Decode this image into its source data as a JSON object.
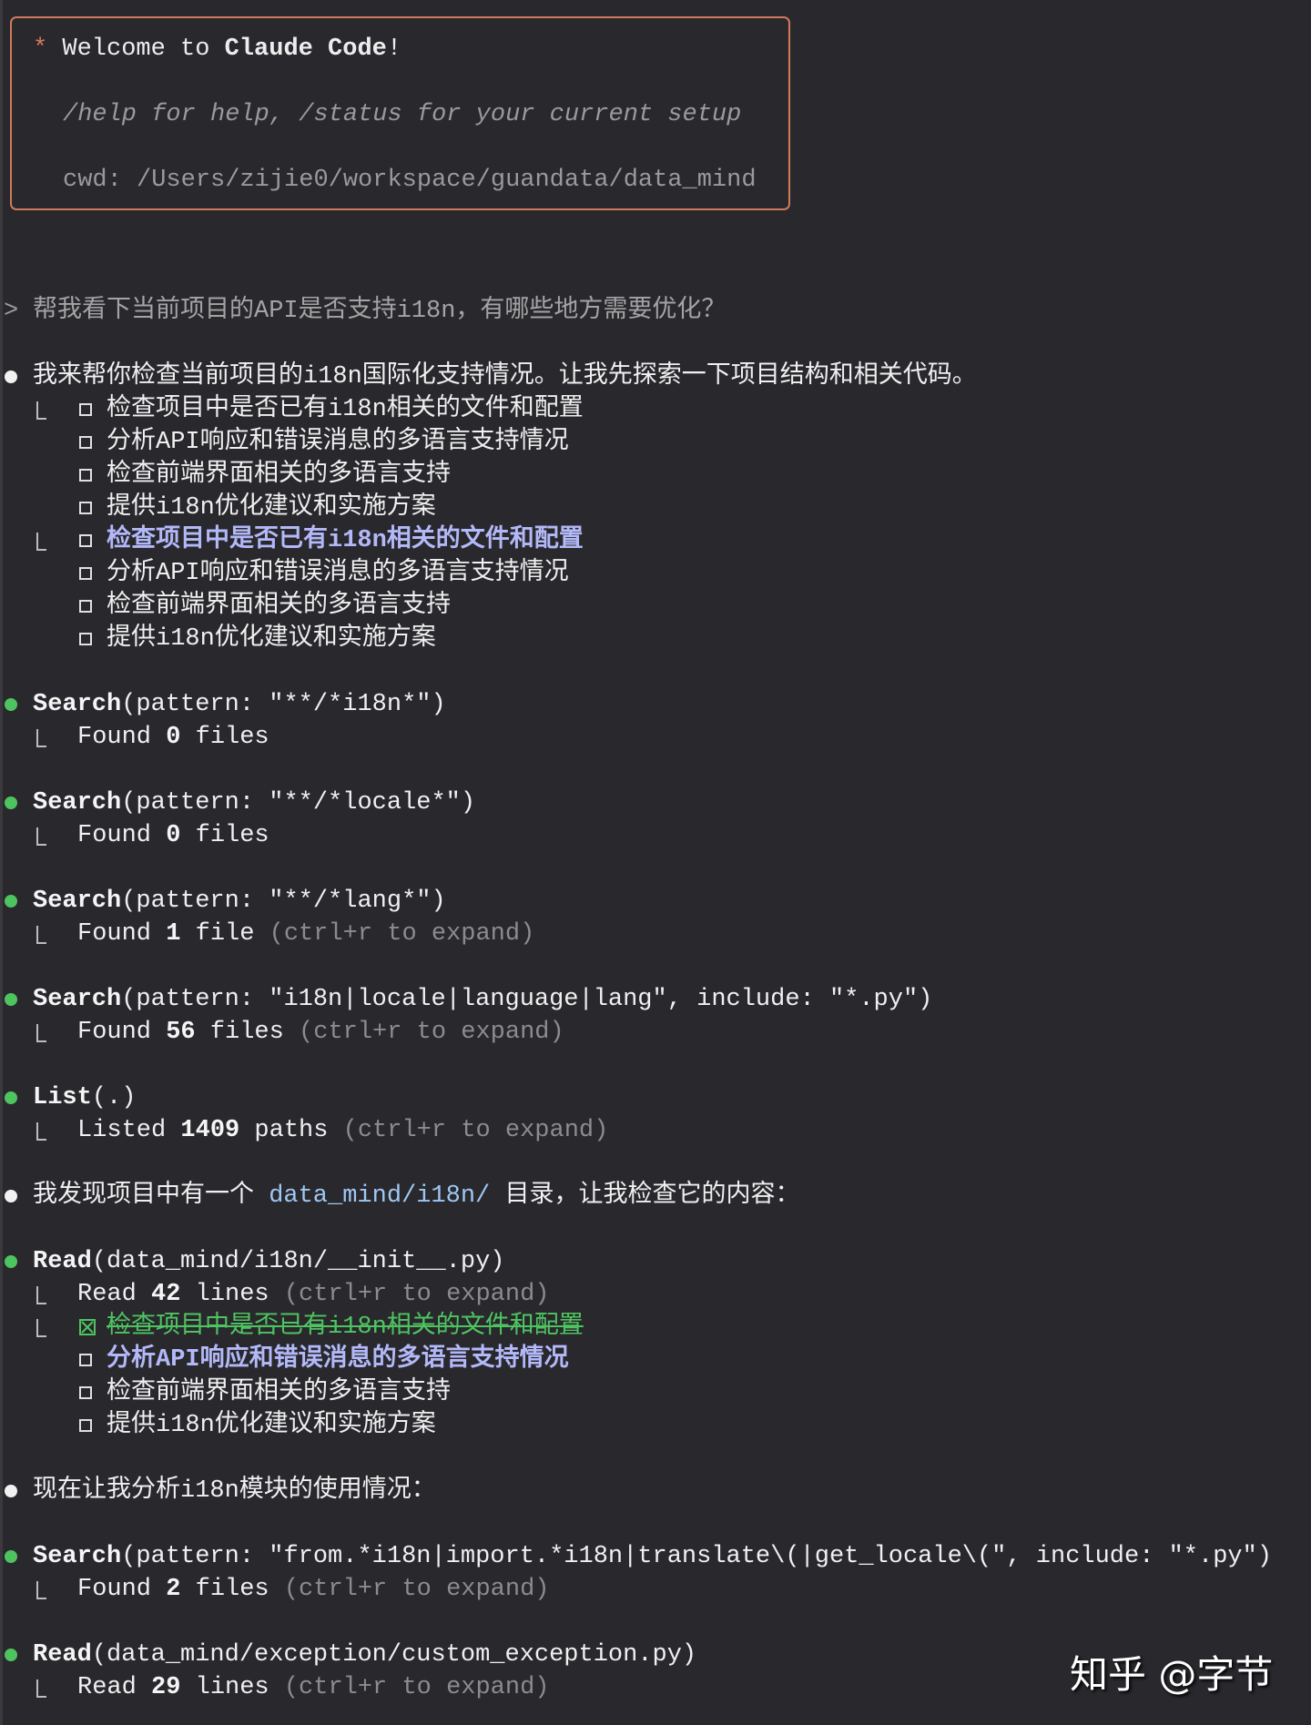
{
  "welcome": {
    "prefix": "Welcome to ",
    "product": "Claude Code",
    "suffix": "!",
    "help": "/help for help, /status for your current setup",
    "cwd": "cwd: /Users/zijie0/workspace/guandata/data_mind"
  },
  "colors": {
    "accent": "#d9785a",
    "success": "#4ec460",
    "active_todo": "#b3b9f8",
    "path_link": "#9fc7f2"
  },
  "transcript": [
    {
      "bullet": "prompt",
      "segments": [
        {
          "t": "帮我看下当前项目的API是否支持i18n，有哪些地方需要优化？",
          "s": "prompt"
        }
      ]
    },
    {
      "bullet": "none",
      "segments": []
    },
    {
      "bullet": "white",
      "segments": [
        {
          "t": "我来帮你检查当前项目的i18n国际化支持情况。让我先探索一下项目结构和相关代码。",
          "s": "text"
        }
      ]
    },
    {
      "bullet": "none",
      "conn": true,
      "todo": "open",
      "segments": [
        {
          "t": "检查项目中是否已有i18n相关的文件和配置",
          "s": "text"
        }
      ]
    },
    {
      "bullet": "none",
      "todo": "open",
      "segments": [
        {
          "t": "分析API响应和错误消息的多语言支持情况",
          "s": "text"
        }
      ]
    },
    {
      "bullet": "none",
      "todo": "open",
      "segments": [
        {
          "t": "检查前端界面相关的多语言支持",
          "s": "text"
        }
      ]
    },
    {
      "bullet": "none",
      "todo": "open",
      "segments": [
        {
          "t": "提供i18n优化建议和实施方案",
          "s": "text"
        }
      ]
    },
    {
      "bullet": "none",
      "conn": true,
      "todo": "open",
      "segments": [
        {
          "t": "检查项目中是否已有i18n相关的文件和配置",
          "s": "active"
        }
      ]
    },
    {
      "bullet": "none",
      "todo": "open",
      "segments": [
        {
          "t": "分析API响应和错误消息的多语言支持情况",
          "s": "text"
        }
      ]
    },
    {
      "bullet": "none",
      "todo": "open",
      "segments": [
        {
          "t": "检查前端界面相关的多语言支持",
          "s": "text"
        }
      ]
    },
    {
      "bullet": "none",
      "todo": "open",
      "segments": [
        {
          "t": "提供i18n优化建议和实施方案",
          "s": "text"
        }
      ]
    },
    {
      "bullet": "none",
      "segments": []
    },
    {
      "bullet": "green",
      "segments": [
        {
          "t": "Search",
          "s": "bold"
        },
        {
          "t": "(pattern: \"**/*i18n*\")",
          "s": "text"
        }
      ]
    },
    {
      "bullet": "none",
      "conn": true,
      "segments": [
        {
          "t": "Found ",
          "s": "text"
        },
        {
          "t": "0",
          "s": "bold"
        },
        {
          "t": " files",
          "s": "text"
        }
      ]
    },
    {
      "bullet": "none",
      "segments": []
    },
    {
      "bullet": "green",
      "segments": [
        {
          "t": "Search",
          "s": "bold"
        },
        {
          "t": "(pattern: \"**/*locale*\")",
          "s": "text"
        }
      ]
    },
    {
      "bullet": "none",
      "conn": true,
      "segments": [
        {
          "t": "Found ",
          "s": "text"
        },
        {
          "t": "0",
          "s": "bold"
        },
        {
          "t": " files",
          "s": "text"
        }
      ]
    },
    {
      "bullet": "none",
      "segments": []
    },
    {
      "bullet": "green",
      "segments": [
        {
          "t": "Search",
          "s": "bold"
        },
        {
          "t": "(pattern: \"**/*lang*\")",
          "s": "text"
        }
      ]
    },
    {
      "bullet": "none",
      "conn": true,
      "segments": [
        {
          "t": "Found ",
          "s": "text"
        },
        {
          "t": "1",
          "s": "bold"
        },
        {
          "t": " file ",
          "s": "text"
        },
        {
          "t": "(ctrl+r to expand)",
          "s": "dim"
        }
      ]
    },
    {
      "bullet": "none",
      "segments": []
    },
    {
      "bullet": "green",
      "segments": [
        {
          "t": "Search",
          "s": "bold"
        },
        {
          "t": "(pattern: \"i18n|locale|language|lang\", include: \"*.py\")",
          "s": "text"
        }
      ]
    },
    {
      "bullet": "none",
      "conn": true,
      "segments": [
        {
          "t": "Found ",
          "s": "text"
        },
        {
          "t": "56",
          "s": "bold"
        },
        {
          "t": " files ",
          "s": "text"
        },
        {
          "t": "(ctrl+r to expand)",
          "s": "dim"
        }
      ]
    },
    {
      "bullet": "none",
      "segments": []
    },
    {
      "bullet": "green",
      "segments": [
        {
          "t": "List",
          "s": "bold"
        },
        {
          "t": "(.)",
          "s": "text"
        }
      ]
    },
    {
      "bullet": "none",
      "conn": true,
      "segments": [
        {
          "t": "Listed ",
          "s": "text"
        },
        {
          "t": "1409",
          "s": "bold"
        },
        {
          "t": " paths ",
          "s": "text"
        },
        {
          "t": "(ctrl+r to expand)",
          "s": "dim"
        }
      ]
    },
    {
      "bullet": "none",
      "segments": []
    },
    {
      "bullet": "white",
      "segments": [
        {
          "t": "我发现项目中有一个 ",
          "s": "text"
        },
        {
          "t": "data_mind/i18n/",
          "s": "link"
        },
        {
          "t": " 目录，让我检查它的内容：",
          "s": "text"
        }
      ]
    },
    {
      "bullet": "none",
      "segments": []
    },
    {
      "bullet": "green",
      "segments": [
        {
          "t": "Read",
          "s": "bold"
        },
        {
          "t": "(data_mind/i18n/__init__.py)",
          "s": "text"
        }
      ]
    },
    {
      "bullet": "none",
      "conn": true,
      "segments": [
        {
          "t": "Read ",
          "s": "text"
        },
        {
          "t": "42",
          "s": "bold"
        },
        {
          "t": " lines ",
          "s": "text"
        },
        {
          "t": "(ctrl+r to expand)",
          "s": "dim"
        }
      ]
    },
    {
      "bullet": "none",
      "conn": true,
      "todo": "done",
      "segments": [
        {
          "t": "检查项目中是否已有i18n相关的文件和配置",
          "s": "done"
        }
      ]
    },
    {
      "bullet": "none",
      "todo": "open",
      "segments": [
        {
          "t": "分析API响应和错误消息的多语言支持情况",
          "s": "active"
        }
      ]
    },
    {
      "bullet": "none",
      "todo": "open",
      "segments": [
        {
          "t": "检查前端界面相关的多语言支持",
          "s": "text"
        }
      ]
    },
    {
      "bullet": "none",
      "todo": "open",
      "segments": [
        {
          "t": "提供i18n优化建议和实施方案",
          "s": "text"
        }
      ]
    },
    {
      "bullet": "none",
      "segments": []
    },
    {
      "bullet": "white",
      "segments": [
        {
          "t": "现在让我分析i18n模块的使用情况：",
          "s": "text"
        }
      ]
    },
    {
      "bullet": "none",
      "segments": []
    },
    {
      "bullet": "green",
      "segments": [
        {
          "t": "Search",
          "s": "bold"
        },
        {
          "t": "(pattern: \"from.*i18n|import.*i18n|translate\\(|get_locale\\(\", include: \"*.py\")",
          "s": "text"
        }
      ]
    },
    {
      "bullet": "none",
      "conn": true,
      "segments": [
        {
          "t": "Found ",
          "s": "text"
        },
        {
          "t": "2",
          "s": "bold"
        },
        {
          "t": " files ",
          "s": "text"
        },
        {
          "t": "(ctrl+r to expand)",
          "s": "dim"
        }
      ]
    },
    {
      "bullet": "none",
      "segments": []
    },
    {
      "bullet": "green",
      "segments": [
        {
          "t": "Read",
          "s": "bold"
        },
        {
          "t": "(data_mind/exception/custom_exception.py)",
          "s": "text"
        }
      ]
    },
    {
      "bullet": "none",
      "conn": true,
      "segments": [
        {
          "t": "Read ",
          "s": "text"
        },
        {
          "t": "29",
          "s": "bold"
        },
        {
          "t": " lines ",
          "s": "text"
        },
        {
          "t": "(ctrl+r to expand)",
          "s": "dim"
        }
      ]
    }
  ],
  "watermark": "知乎 @字节"
}
